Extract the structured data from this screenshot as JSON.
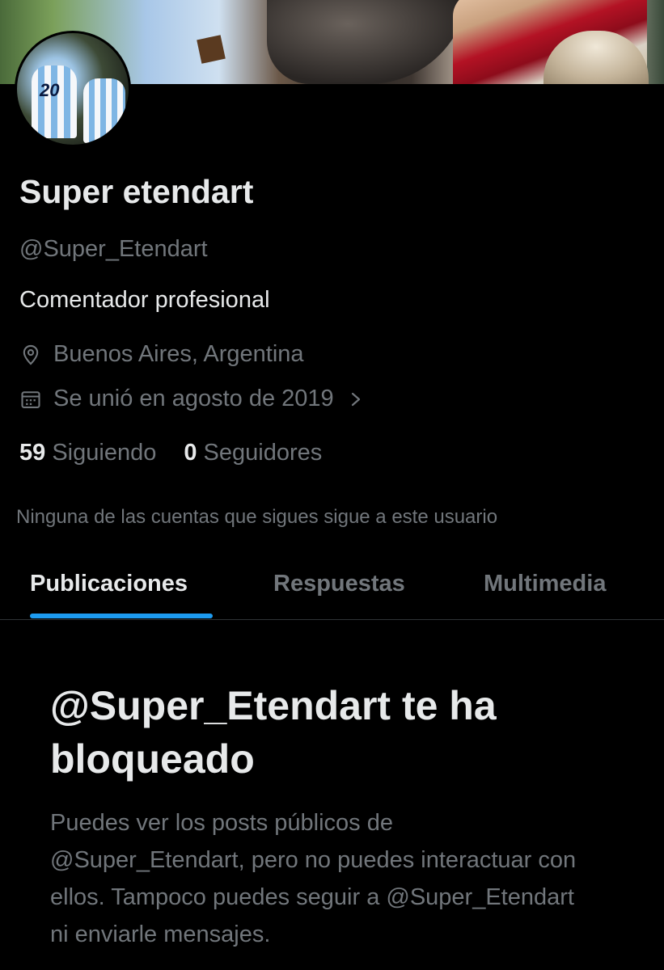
{
  "profile": {
    "display_name": "Super etendart",
    "handle": "@Super_Etendart",
    "bio": "Comentador profesional",
    "location": "Buenos Aires, Argentina",
    "joined": "Se unió en agosto de 2019",
    "following_count": "59",
    "following_label": "Siguiendo",
    "followers_count": "0",
    "followers_label": "Seguidores",
    "mutual_note": "Ninguna de las cuentas que sigues sigue a este usuario",
    "avatar_jersey_number": "20"
  },
  "tabs": [
    {
      "label": "Publicaciones",
      "active": true
    },
    {
      "label": "Respuestas",
      "active": false
    },
    {
      "label": "Multimedia",
      "active": false
    }
  ],
  "blocked": {
    "title": "@Super_Etendart te ha bloqueado",
    "message": "Puedes ver los posts públicos de @Super_Etendart, pero no puedes interactuar con ellos. Tampoco puedes seguir a @Super_Etendart ni enviarle mensajes."
  },
  "colors": {
    "background": "#000000",
    "primary_text": "#e7e9ea",
    "secondary_text": "#71767b",
    "accent": "#1d9bf0"
  },
  "icons": {
    "location": "location-pin-icon",
    "calendar": "calendar-icon",
    "chevron": "chevron-right-icon"
  }
}
